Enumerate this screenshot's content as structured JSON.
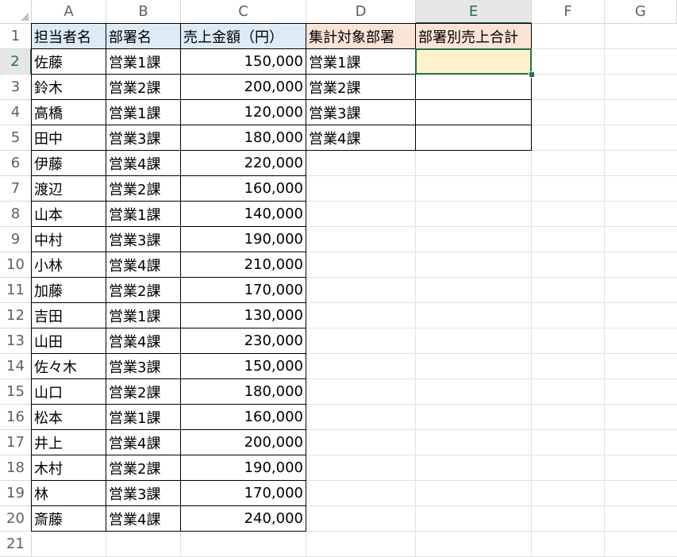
{
  "columns": [
    "A",
    "B",
    "C",
    "D",
    "E",
    "F",
    "G"
  ],
  "rows": [
    "1",
    "2",
    "3",
    "4",
    "5",
    "6",
    "7",
    "8",
    "9",
    "10",
    "11",
    "12",
    "13",
    "14",
    "15",
    "16",
    "17",
    "18",
    "19",
    "20",
    "21"
  ],
  "active_cell": "E2",
  "headers": {
    "a1": "担当者名",
    "b1": "部署名",
    "c1": "売上金額（円）",
    "d1": "集計対象部署",
    "e1": "部署別売上合計"
  },
  "records": [
    {
      "name": "佐藤",
      "dept": "営業1課",
      "amount": "150,000"
    },
    {
      "name": "鈴木",
      "dept": "営業2課",
      "amount": "200,000"
    },
    {
      "name": "高橋",
      "dept": "営業1課",
      "amount": "120,000"
    },
    {
      "name": "田中",
      "dept": "営業3課",
      "amount": "180,000"
    },
    {
      "name": "伊藤",
      "dept": "営業4課",
      "amount": "220,000"
    },
    {
      "name": "渡辺",
      "dept": "営業2課",
      "amount": "160,000"
    },
    {
      "name": "山本",
      "dept": "営業1課",
      "amount": "140,000"
    },
    {
      "name": "中村",
      "dept": "営業3課",
      "amount": "190,000"
    },
    {
      "name": "小林",
      "dept": "営業4課",
      "amount": "210,000"
    },
    {
      "name": "加藤",
      "dept": "営業2課",
      "amount": "170,000"
    },
    {
      "name": "吉田",
      "dept": "営業1課",
      "amount": "130,000"
    },
    {
      "name": "山田",
      "dept": "営業4課",
      "amount": "230,000"
    },
    {
      "name": "佐々木",
      "dept": "営業3課",
      "amount": "150,000"
    },
    {
      "name": "山口",
      "dept": "営業2課",
      "amount": "180,000"
    },
    {
      "name": "松本",
      "dept": "営業1課",
      "amount": "160,000"
    },
    {
      "name": "井上",
      "dept": "営業4課",
      "amount": "200,000"
    },
    {
      "name": "木村",
      "dept": "営業2課",
      "amount": "190,000"
    },
    {
      "name": "林",
      "dept": "営業3課",
      "amount": "170,000"
    },
    {
      "name": "斎藤",
      "dept": "営業4課",
      "amount": "240,000"
    }
  ],
  "summary": [
    {
      "dept": "営業1課",
      "total": ""
    },
    {
      "dept": "営業2課",
      "total": ""
    },
    {
      "dept": "営業3課",
      "total": ""
    },
    {
      "dept": "営業4課",
      "total": ""
    }
  ],
  "colors": {
    "header_blue": "#ddebf7",
    "header_orange": "#fbe3d6",
    "active_fill": "#fff2cc",
    "selection": "#217346"
  }
}
